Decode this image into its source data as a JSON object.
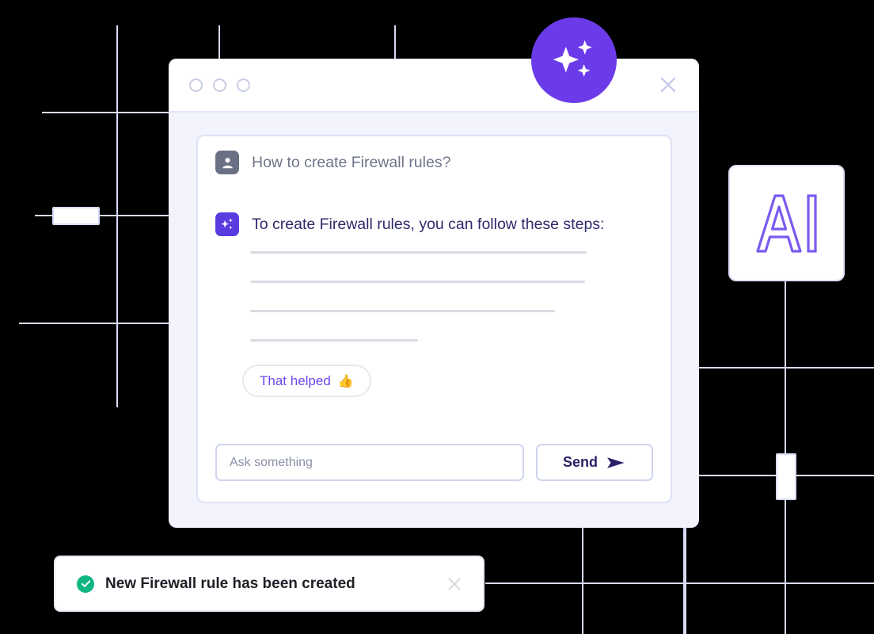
{
  "window": {
    "traffic_lights": [
      "dot-1",
      "dot-2",
      "dot-3"
    ],
    "close_icon": "close-icon",
    "badge_icon": "sparkles-icon"
  },
  "chat": {
    "user_message": {
      "avatar_icon": "user-avatar-icon",
      "text": "How to create Firewall rules?"
    },
    "ai_message": {
      "avatar_icon": "sparkles-icon",
      "text": "To create Firewall rules, you can follow these steps:"
    },
    "skeleton_widths": [
      425,
      423,
      385,
      212
    ],
    "feedback_button": {
      "label": "That helped",
      "emoji": "👍"
    },
    "input": {
      "placeholder": "Ask something",
      "value": ""
    },
    "send_button": {
      "label": "Send",
      "icon": "send-arrow-icon"
    }
  },
  "ai_card": {
    "label": "AI"
  },
  "toast": {
    "status_icon": "success-check-icon",
    "message": "New Firewall rule has been created",
    "close_icon": "close-icon"
  },
  "colors": {
    "accent_purple": "#6B3BEA",
    "ai_avatar_purple": "#5A3BE0",
    "user_avatar_gray": "#6B7185",
    "grid_line": "#D8DCF5",
    "window_body": "#F2F3FD",
    "success_green": "#0FB682",
    "send_navy": "#2C1F66"
  }
}
